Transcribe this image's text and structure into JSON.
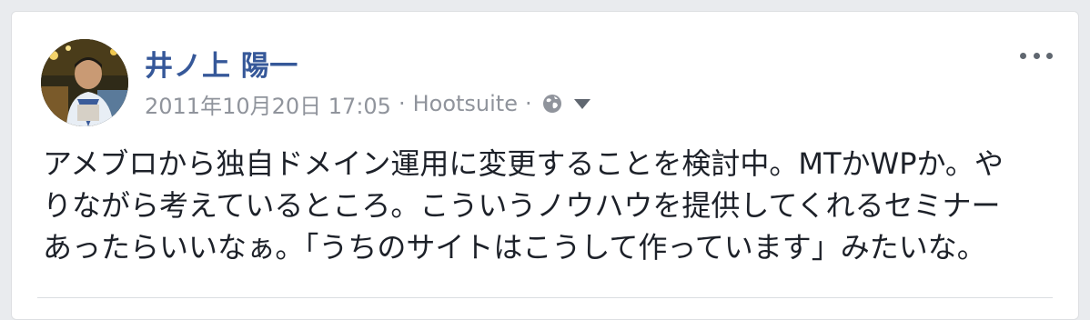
{
  "post": {
    "author_name": "井ノ上 陽一",
    "timestamp": "2011年10月20日 17:05",
    "separator": "·",
    "app_name": "Hootsuite",
    "privacy_icon": "globe-icon",
    "audience_menu_icon": "caret-down-icon",
    "more_options_icon": "ellipsis-icon",
    "text_lines": [
      "アメブロから独自ドメイン運用に変更することを検討中。MTかWPか。や",
      "りながら考えているところ。こういうノウハウを提供してくれるセミナー",
      "あったらいいなぁ。「うちのサイトはこうして作っています」みたいな。"
    ]
  },
  "colors": {
    "author_link": "#365899",
    "meta_text": "#90949c",
    "body_text": "#1d2129",
    "background": "#e9ebee"
  }
}
